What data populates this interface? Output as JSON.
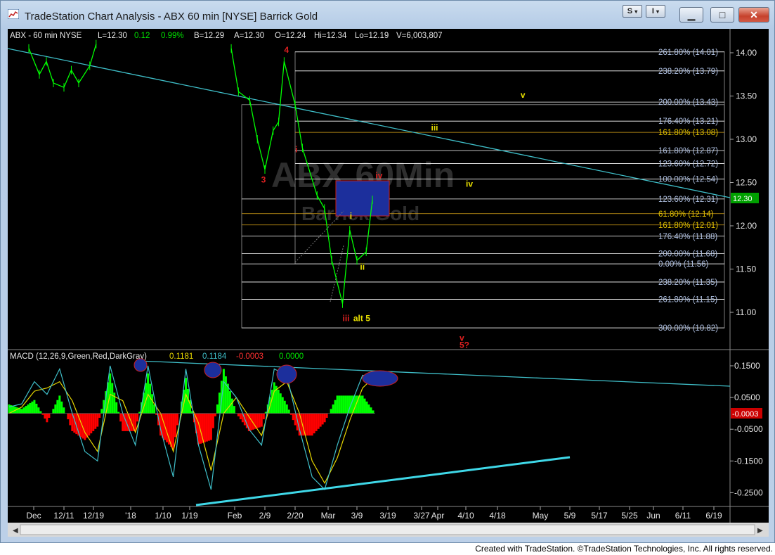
{
  "window": {
    "title": "TradeStation Chart Analysis - ABX 60 min [NYSE] Barrick Gold",
    "style_btn_1": "S",
    "style_btn_2": "I",
    "minimize": "▁",
    "maximize": "□",
    "close": "✕"
  },
  "header": {
    "symbol": "ABX - 60 min  NYSE",
    "last": "L=12.30",
    "change": "0.12",
    "pct": "0.99%",
    "bid": "B=12.29",
    "ask": "A=12.30",
    "open": "O=12.24",
    "high": "Hi=12.34",
    "low": "Lo=12.19",
    "volume": "V=6,003,807"
  },
  "watermark": {
    "line1": "ABX 60Min",
    "line2": "Barrick Gold"
  },
  "colors": {
    "price_line": "#00ff00",
    "fib_line": "#ffffff",
    "fib_gold_line": "#d4a017",
    "fib_label": "#aebfe0",
    "fib_label_gold": "#e0c000",
    "trendline": "#3fbfc9",
    "wave_red": "#e02020",
    "wave_yellow": "#e8e000",
    "macd_line": "#3fbfc9",
    "signal_line": "#e8d800",
    "hist_pos": "#00ff00",
    "hist_neg": "#ff0000",
    "box_fill": "#1c2f9c",
    "box_border": "#cc2020",
    "last_price_tag": "#00a000"
  },
  "chart_data": [
    {
      "type": "line",
      "title": "ABX - 60 min NYSE",
      "ylim": [
        10.75,
        14.1
      ],
      "y_ticks": [
        "14.00",
        "13.50",
        "13.00",
        "12.50",
        "12.00",
        "11.50",
        "11.00"
      ],
      "last_price_tag": "12.30",
      "x_ticks": [
        "Dec",
        "12/11",
        "12/19",
        "'18",
        "1/10",
        "1/19",
        "Feb",
        "2/9",
        "2/20",
        "Mar",
        "3/9",
        "3/19",
        "3/27",
        "Apr",
        "4/10",
        "4/18",
        "May",
        "5/9",
        "5/17",
        "5/25",
        "Jun",
        "6/11",
        "6/19"
      ],
      "series": [
        {
          "name": "ABX",
          "values": [
            {
              "x": "2017-12-01",
              "y": 14.05
            },
            {
              "x": "2017-12-04",
              "y": 13.75
            },
            {
              "x": "2017-12-06",
              "y": 13.9
            },
            {
              "x": "2017-12-08",
              "y": 13.65
            },
            {
              "x": "2017-12-11",
              "y": 13.6
            },
            {
              "x": "2017-12-13",
              "y": 13.8
            },
            {
              "x": "2017-12-15",
              "y": 13.65
            },
            {
              "x": "2017-12-18",
              "y": 13.85
            },
            {
              "x": "2017-12-20",
              "y": 14.1
            },
            {
              "x": "2018-01-31",
              "y": 14.05
            },
            {
              "x": "2018-02-02",
              "y": 13.55
            },
            {
              "x": "2018-02-05",
              "y": 13.45
            },
            {
              "x": "2018-02-07",
              "y": 13.0
            },
            {
              "x": "2018-02-09",
              "y": 12.65
            },
            {
              "x": "2018-02-12",
              "y": 13.1
            },
            {
              "x": "2018-02-14",
              "y": 13.2
            },
            {
              "x": "2018-02-16",
              "y": 13.9
            },
            {
              "x": "2018-02-20",
              "y": 13.4
            },
            {
              "x": "2018-02-22",
              "y": 12.9
            },
            {
              "x": "2018-02-26",
              "y": 12.35
            },
            {
              "x": "2018-02-28",
              "y": 12.2
            },
            {
              "x": "2018-03-02",
              "y": 11.6
            },
            {
              "x": "2018-03-05",
              "y": 11.1
            },
            {
              "x": "2018-03-07",
              "y": 11.95
            },
            {
              "x": "2018-03-09",
              "y": 11.6
            },
            {
              "x": "2018-03-12",
              "y": 11.7
            },
            {
              "x": "2018-03-14",
              "y": 12.3
            }
          ]
        }
      ],
      "fib_levels": [
        {
          "label": "261.80% (14.01)",
          "value": 14.01
        },
        {
          "label": "238.20% (13.79)",
          "value": 13.79
        },
        {
          "label": "200.00% (13.43)",
          "value": 13.43
        },
        {
          "label": "176.40% (13.21)",
          "value": 13.21
        },
        {
          "label": "161.80% (13.08)",
          "value": 13.08,
          "gold": true
        },
        {
          "label": "161.80% (12.87)",
          "value": 12.87
        },
        {
          "label": "123.60% (12.72)",
          "value": 12.72
        },
        {
          "label": "100.00% (12.54)",
          "value": 12.54
        },
        {
          "label": "123.60% (12.31)",
          "value": 12.31
        },
        {
          "label": "61.80% (12.14)",
          "value": 12.14,
          "gold": true
        },
        {
          "label": "161.80% (12.01)",
          "value": 12.01,
          "gold": true
        },
        {
          "label": "176.40% (11.88)",
          "value": 11.88
        },
        {
          "label": "200.00% (11.68)",
          "value": 11.68
        },
        {
          "label": "0.00% (11.56)",
          "value": 11.56
        },
        {
          "label": "238.20% (11.35)",
          "value": 11.35
        },
        {
          "label": "261.80% (11.15)",
          "value": 11.15
        },
        {
          "label": "300.00% (10.82)",
          "value": 10.82
        }
      ],
      "wave_labels": [
        {
          "text": "4",
          "color": "red",
          "x": "2018-02-16",
          "y": 14.0
        },
        {
          "text": "3",
          "color": "red",
          "x": "2018-02-08",
          "y": 12.5
        },
        {
          "text": "i",
          "color": "red",
          "x": "2018-02-20",
          "y": 12.85
        },
        {
          "text": "iv",
          "color": "red",
          "x": "2018-03-15",
          "y": 12.55
        },
        {
          "text": "iii",
          "color": "red",
          "x": "2018-03-05",
          "y": 10.9
        },
        {
          "text": "alt 5",
          "color": "yellow",
          "x": "2018-03-08",
          "y": 10.9
        },
        {
          "text": "i",
          "color": "yellow",
          "x": "2018-03-07",
          "y": 12.08
        },
        {
          "text": "ii",
          "color": "yellow",
          "x": "2018-03-10",
          "y": 11.49
        },
        {
          "text": "iii",
          "color": "yellow",
          "x": "2018-03-30",
          "y": 13.1
        },
        {
          "text": "iv",
          "color": "yellow",
          "x": "2018-04-10",
          "y": 12.45
        },
        {
          "text": "v",
          "color": "yellow",
          "x": "2018-04-25",
          "y": 13.48
        },
        {
          "text": "v",
          "color": "red",
          "x": "2018-04-08",
          "y": 10.67
        },
        {
          "text": "5?",
          "color": "red",
          "x": "2018-04-08",
          "y": 10.59
        }
      ]
    },
    {
      "type": "line",
      "title": "MACD (12,26,9,Green,Red,DarkGray)",
      "ylim": [
        -0.28,
        0.16
      ],
      "y_ticks": [
        "0.1500",
        "0.0500",
        "-0.0500",
        "-0.1500",
        "-0.2500"
      ],
      "last_value_tag": "-0.0003",
      "legend_values": [
        "0.1181",
        "0.1184",
        "-0.0003",
        "0.0000"
      ],
      "series": [
        {
          "name": "MACD",
          "values": [
            0.02,
            0.03,
            0.1,
            0.06,
            0.14,
            0.0,
            -0.12,
            -0.15,
            0.15,
            0.0,
            -0.1,
            0.15,
            -0.05,
            -0.2,
            0.14,
            -0.1,
            -0.24,
            0.1,
            0.05,
            -0.05,
            -0.1,
            0.14,
            0.12,
            -0.05,
            -0.2,
            -0.24,
            -0.1,
            0.02,
            0.12,
            0.118
          ]
        },
        {
          "name": "Signal",
          "values": [
            0.0,
            0.02,
            0.07,
            0.08,
            0.1,
            0.04,
            -0.06,
            -0.12,
            0.06,
            0.04,
            -0.06,
            0.06,
            0.0,
            -0.12,
            0.06,
            -0.03,
            -0.18,
            0.0,
            0.05,
            -0.01,
            -0.07,
            0.07,
            0.1,
            0.0,
            -0.15,
            -0.22,
            -0.14,
            -0.02,
            0.08,
            0.118
          ]
        }
      ]
    }
  ],
  "footer": {
    "credit": "Created with TradeStation. ©TradeStation Technologies, Inc. All rights reserved."
  }
}
